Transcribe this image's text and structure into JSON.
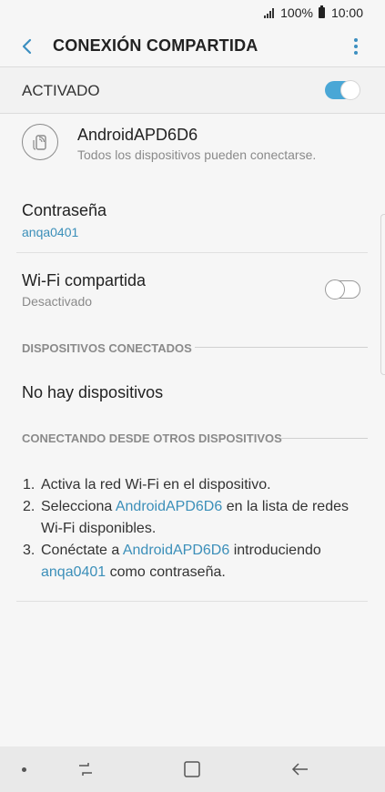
{
  "status_bar": {
    "battery": "100%",
    "time": "10:00"
  },
  "app_bar": {
    "title": "CONEXIÓN COMPARTIDA"
  },
  "main_switch": {
    "label": "ACTIVADO",
    "enabled": true
  },
  "network": {
    "name": "AndroidAPD6D6",
    "description": "Todos los dispositivos pueden conectarse."
  },
  "password": {
    "label": "Contraseña",
    "value": "anqa0401"
  },
  "wifi_sharing": {
    "label": "Wi-Fi compartida",
    "status": "Desactivado",
    "enabled": false
  },
  "connected_devices": {
    "header": "DISPOSITIVOS CONECTADOS",
    "empty_text": "No hay dispositivos"
  },
  "connecting": {
    "header": "CONECTANDO DESDE OTROS DISPOSITIVOS",
    "steps": [
      {
        "num": "1.",
        "parts": [
          "Activa la red Wi-Fi en el dispositivo."
        ]
      },
      {
        "num": "2.",
        "parts": [
          "Selecciona ",
          "AndroidAPD6D6",
          " en la lista de redes Wi-Fi disponibles."
        ]
      },
      {
        "num": "3.",
        "parts": [
          "Conéctate a ",
          "AndroidAPD6D6",
          " introduciendo ",
          "anqa0401",
          " como contraseña."
        ]
      }
    ]
  },
  "colors": {
    "accent": "#3b8fb9",
    "toggle_on": "#4aa7d6",
    "background": "#f6f6f6"
  },
  "icons": [
    "back-arrow-icon",
    "more-options-icon",
    "mobile-hotspot-icon",
    "recent-apps-icon",
    "home-icon",
    "nav-back-icon"
  ]
}
